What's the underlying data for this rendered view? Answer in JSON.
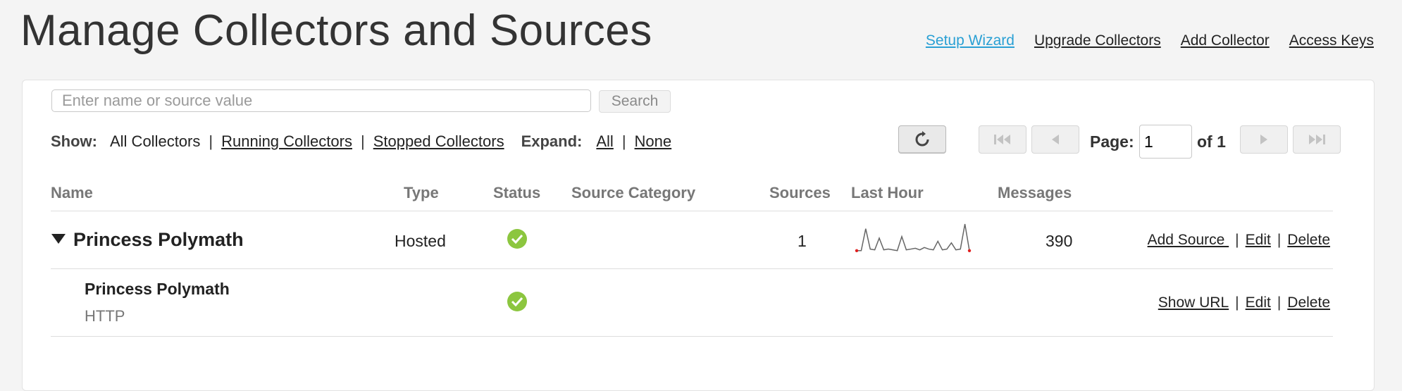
{
  "header": {
    "title": "Manage Collectors and Sources",
    "links": {
      "setup_wizard": "Setup Wizard",
      "upgrade_collectors": "Upgrade Collectors",
      "add_collector": "Add Collector",
      "access_keys": "Access Keys"
    },
    "accent_color": "#2aa0d4"
  },
  "search": {
    "placeholder": "Enter name or source value",
    "value": "",
    "button_label": "Search"
  },
  "filters": {
    "show_label": "Show:",
    "all_collectors": "All Collectors",
    "running_collectors": "Running Collectors",
    "stopped_collectors": "Stopped Collectors",
    "separator": "|",
    "expand_label": "Expand:",
    "expand_all": "All",
    "expand_none": "None"
  },
  "pagination": {
    "refresh_icon": "refresh-icon",
    "page_label": "Page:",
    "page_value": "1",
    "of_label": "of 1"
  },
  "table": {
    "columns": {
      "name": "Name",
      "type": "Type",
      "status": "Status",
      "source_category": "Source Category",
      "sources": "Sources",
      "last_hour": "Last Hour",
      "messages": "Messages"
    },
    "collector": {
      "name": "Princess Polymath",
      "type": "Hosted",
      "status_icon": "check-circle-icon",
      "sources": "1",
      "sparkline": [
        2,
        2,
        30,
        4,
        3,
        18,
        3,
        4,
        3,
        2,
        20,
        3,
        4,
        5,
        3,
        6,
        4,
        3,
        14,
        3,
        4,
        12,
        3,
        4,
        36,
        2
      ],
      "messages": "390",
      "actions": {
        "add_source": "Add Source ",
        "edit": "Edit",
        "delete": "Delete"
      }
    },
    "source": {
      "name": "Princess Polymath",
      "kind": "HTTP",
      "status_icon": "check-circle-icon",
      "actions": {
        "show_url": "Show URL",
        "edit": "Edit",
        "delete": "Delete"
      }
    },
    "status_color": "#8cc63f"
  }
}
